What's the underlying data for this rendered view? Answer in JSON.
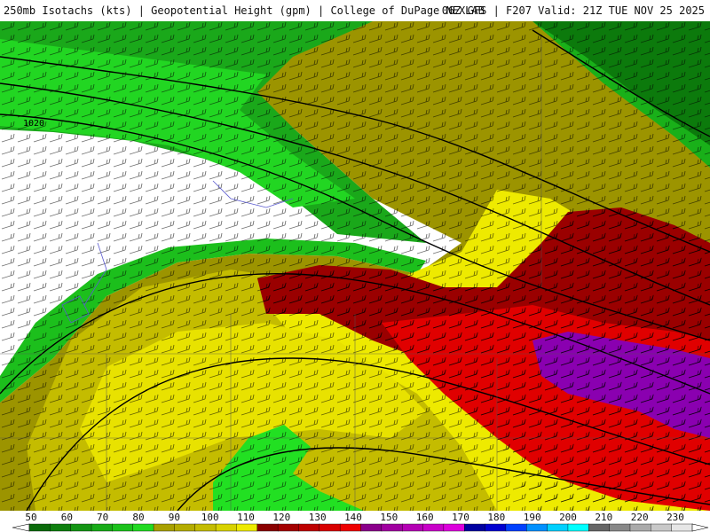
{
  "header": {
    "left_title": "250mb Isotachs (kts) | Geopotential Height (gpm) | College of DuPage NEXLAB",
    "right_title": "06Z GFS | F207 Valid: 21Z TUE NOV 25 2025"
  },
  "map": {
    "contour_label": "1020",
    "region_colors": {
      "under_50": "#ffffff",
      "green_dark": "#0c7a0c",
      "green": "#19b019",
      "green_bright": "#22e022",
      "olive": "#9c9400",
      "olive_light": "#c4bc00",
      "yellow": "#f0ee00",
      "maroon": "#9a0000",
      "red": "#e00000",
      "purple": "#8a00b0"
    }
  },
  "colorbar": {
    "ticks": [
      "50",
      "60",
      "70",
      "80",
      "90",
      "100",
      "110",
      "120",
      "130",
      "140",
      "150",
      "160",
      "170",
      "180",
      "190",
      "200",
      "210",
      "220",
      "230"
    ],
    "colors": [
      "#0b6b0b",
      "#0f7f0f",
      "#149514",
      "#18ab18",
      "#1cc21c",
      "#22da22",
      "#a8a000",
      "#b4ac00",
      "#c4bc00",
      "#d8d200",
      "#eeea00",
      "#8a0000",
      "#a40000",
      "#be0000",
      "#d80000",
      "#ee0000",
      "#8a008a",
      "#a000a0",
      "#b400b4",
      "#c800c8",
      "#dc00dc",
      "#0000a0",
      "#0000d0",
      "#0040ff",
      "#0090ff",
      "#00d0ff",
      "#00ffff",
      "#666666",
      "#888888",
      "#aaaaaa",
      "#c8c8c8",
      "#e6e6e6"
    ]
  }
}
